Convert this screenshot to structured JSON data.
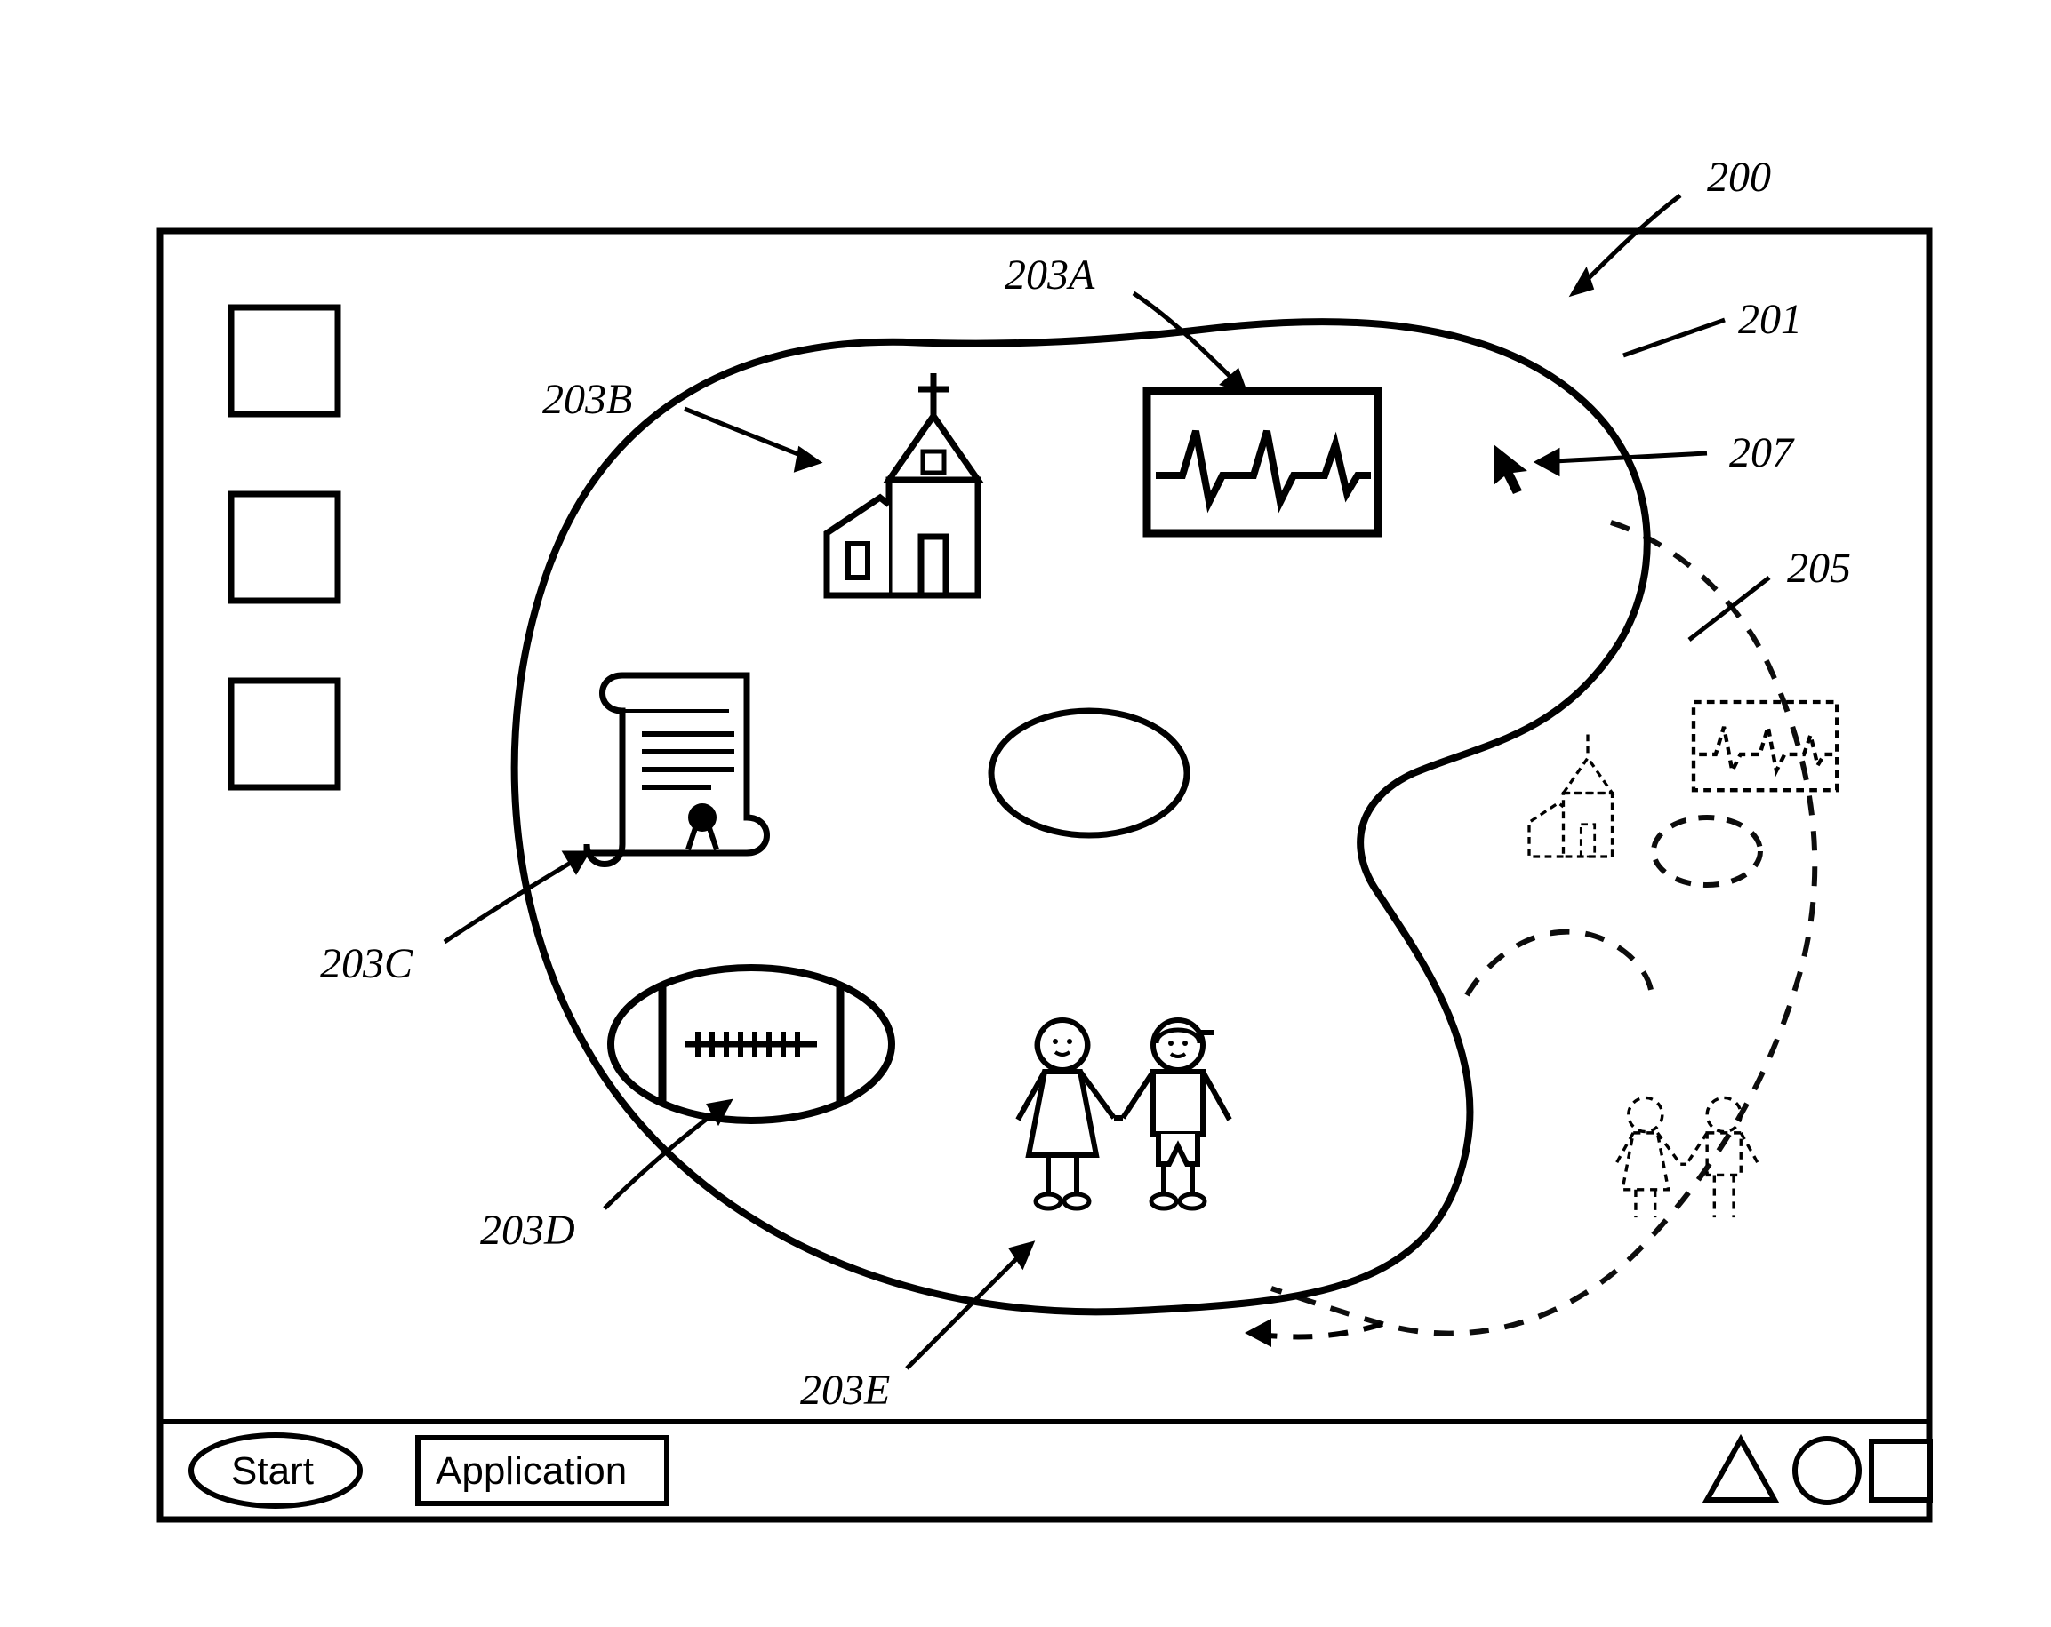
{
  "desktop": {
    "ref_labels": {
      "200": "200",
      "201": "201",
      "203A": "203A",
      "203B": "203B",
      "203C": "203C",
      "203D": "203D",
      "203E": "203E",
      "205": "205",
      "207": "207"
    }
  },
  "taskbar": {
    "start_label": "Start",
    "application_label": "Application"
  },
  "palette": {
    "icons": {
      "203A": "ekg-monitor-icon",
      "203B": "church-icon",
      "203C": "certificate-scroll-icon",
      "203D": "football-icon",
      "203E": "children-icon"
    }
  }
}
